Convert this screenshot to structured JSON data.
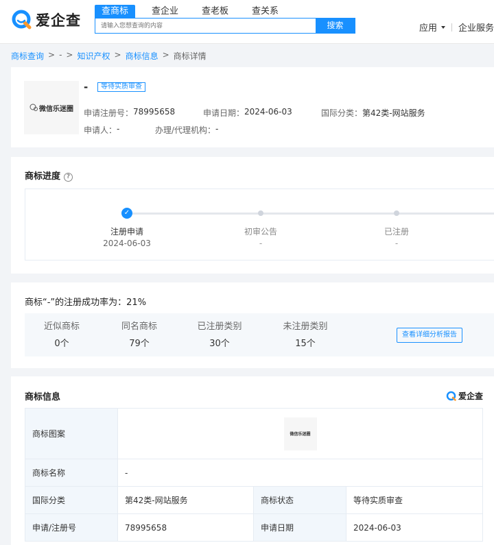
{
  "header": {
    "logo_text": "爱企查",
    "tabs": [
      "查商标",
      "查企业",
      "查老板",
      "查关系"
    ],
    "search_placeholder": "请输入您想查询的内容",
    "search_button": "搜索",
    "nav_app": "应用",
    "nav_enterprise": "企业服务"
  },
  "breadcrumb": {
    "items": [
      "商标查询",
      ">",
      "-",
      ">",
      "知识产权",
      ">",
      "商标信息",
      ">",
      "商标详情"
    ]
  },
  "summary": {
    "thumb_text": "微信乐迷圈",
    "name": "-",
    "status_tag": "等待实质审查",
    "reg_no_label": "申请注册号：",
    "reg_no": "78995658",
    "apply_date_label": "申请日期：",
    "apply_date": "2024-06-03",
    "intl_class_label": "国际分类：",
    "intl_class": "第42类-网站服务",
    "applicant_label": "申请人：",
    "applicant": "-",
    "agency_label": "办理/代理机构：",
    "agency": "-"
  },
  "progress": {
    "title": "商标进度",
    "help": "?",
    "check": "✓",
    "steps": [
      {
        "label": "注册申请",
        "date": "2024-06-03",
        "done": true
      },
      {
        "label": "初审公告",
        "date": "-",
        "done": false
      },
      {
        "label": "已注册",
        "date": "-",
        "done": false
      }
    ]
  },
  "success": {
    "title": "商标“-”的注册成功率为：21%",
    "stats": [
      {
        "label": "近似商标",
        "value": "0个"
      },
      {
        "label": "同名商标",
        "value": "79个"
      },
      {
        "label": "已注册类别",
        "value": "30个"
      },
      {
        "label": "未注册类别",
        "value": "15个"
      }
    ],
    "report_button": "查看详细分析报告"
  },
  "trademark_info": {
    "title": "商标信息",
    "corner_logo": "爱企查",
    "image_label": "商标图案",
    "image_text": "微信乐迷圈",
    "name_label": "商标名称",
    "name_value": "-",
    "intl_label": "国际分类",
    "intl_value": "第42类-网站服务",
    "status_label": "商标状态",
    "status_value": "等待实质审查",
    "regno_label": "申请/注册号",
    "regno_value": "78995658",
    "date_label": "申请日期",
    "date_value": "2024-06-03"
  },
  "colors": {
    "accent": "#1890ff",
    "logo_orange": "#ff9a2e"
  }
}
